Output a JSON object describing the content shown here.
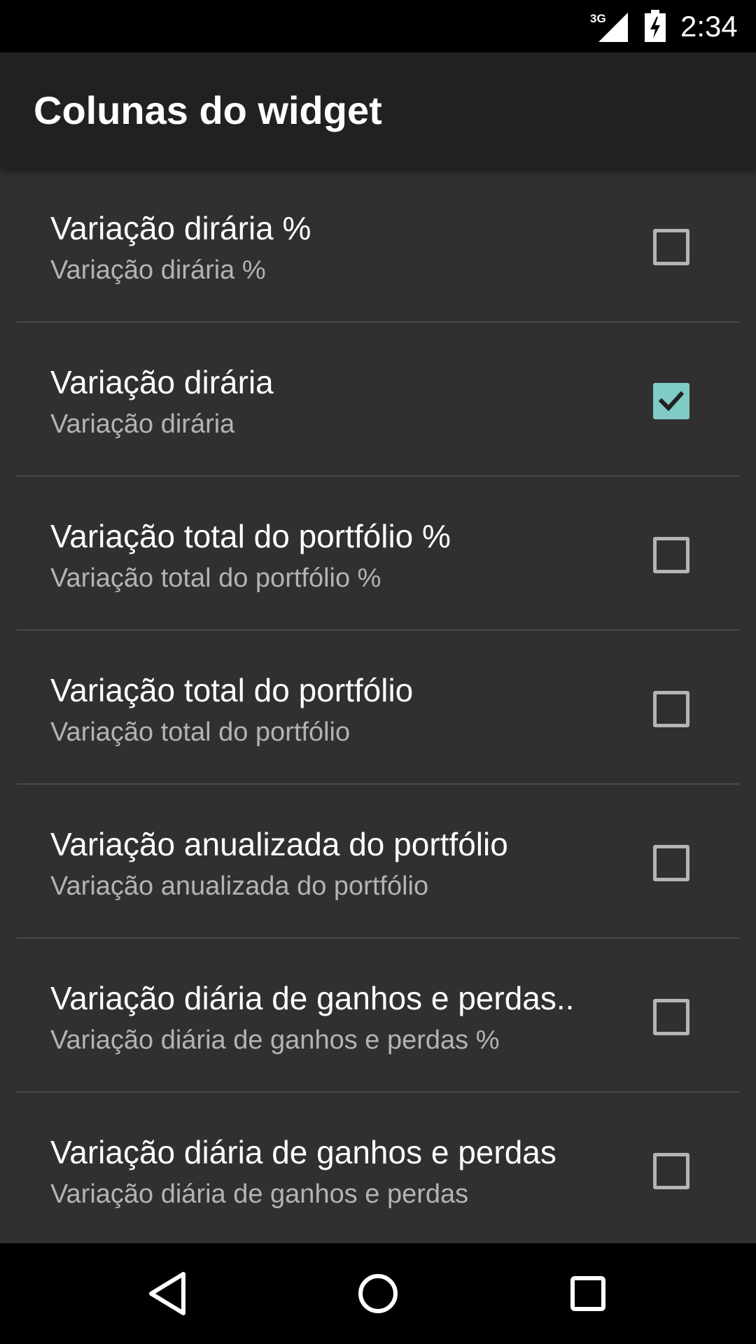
{
  "status_bar": {
    "network": "3G",
    "time": "2:34"
  },
  "toolbar": {
    "title": "Colunas do widget"
  },
  "items": [
    {
      "label": "Variação dirária %",
      "summary": "Variação dirária %",
      "checked": false
    },
    {
      "label": "Variação dirária",
      "summary": "Variação dirária",
      "checked": true
    },
    {
      "label": "Variação total do portfólio %",
      "summary": "Variação total do portfólio %",
      "checked": false
    },
    {
      "label": "Variação total do portfólio",
      "summary": "Variação total do portfólio",
      "checked": false
    },
    {
      "label": "Variação anualizada do portfólio",
      "summary": "Variação anualizada do portfólio",
      "checked": false
    },
    {
      "label": "Variação diária de ganhos e perdas..",
      "summary": "Variação diária de ganhos e perdas %",
      "checked": false
    },
    {
      "label": "Variação diária de ganhos e perdas",
      "summary": "Variação diária de ganhos e perdas",
      "checked": false
    }
  ],
  "nav": {
    "back": "back-icon",
    "home": "home-icon",
    "recents": "recents-icon"
  },
  "colors": {
    "background": "#303030",
    "toolbar": "#212121",
    "accent": "#80cbc4"
  }
}
